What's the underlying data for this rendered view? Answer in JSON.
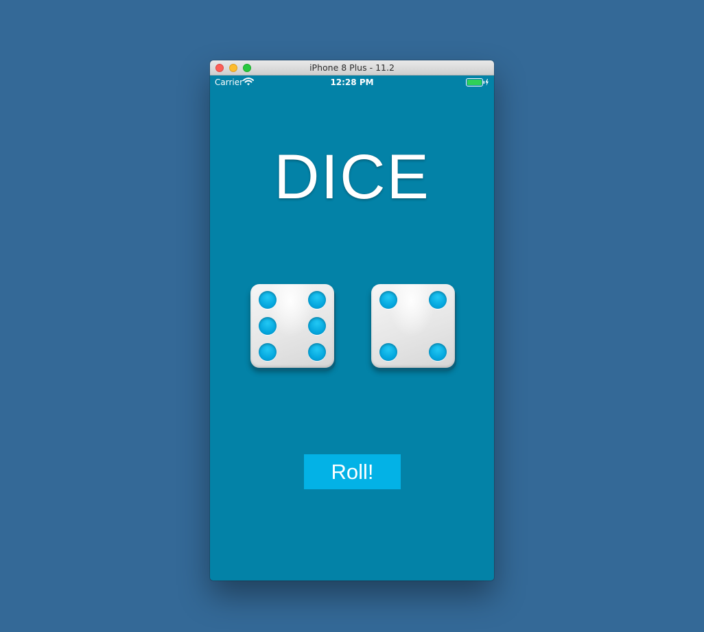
{
  "window": {
    "title": "iPhone 8 Plus - 11.2"
  },
  "statusbar": {
    "carrier": "Carrier",
    "time": "12:28 PM",
    "battery_level": 1.0,
    "charging": true
  },
  "app": {
    "title": "DICE",
    "dice": [
      {
        "value": 6
      },
      {
        "value": 4
      }
    ],
    "roll_button_label": "Roll!"
  },
  "colors": {
    "desktop_background": "#346997",
    "screen_background": "#0382a7",
    "button_background": "#03b2e6",
    "pip": "#05a7de",
    "battery_fill": "#2fd158"
  },
  "icons": {
    "wifi": "wifi-icon",
    "battery": "battery-icon",
    "charging": "charging-bolt-icon"
  }
}
